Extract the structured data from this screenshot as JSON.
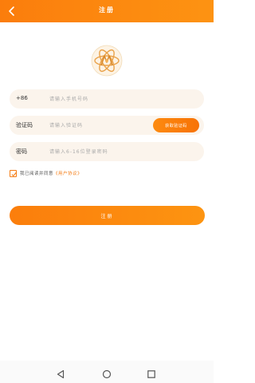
{
  "header": {
    "title": "注册",
    "back_icon": "chevron-left-icon"
  },
  "logo": {
    "icon": "atom-logo-icon"
  },
  "form": {
    "phone": {
      "label": "+86",
      "placeholder": "请输入手机号码"
    },
    "code": {
      "label": "验证码",
      "placeholder": "请输入验证码",
      "button_label": "获取验证码"
    },
    "password": {
      "label": "密码",
      "placeholder": "请输入6-16位登录密码"
    }
  },
  "agreement": {
    "checked": true,
    "text": "我已阅读并同意",
    "link": "《用户协议》"
  },
  "submit": {
    "label": "注册"
  },
  "colors": {
    "accent": "#f77d0b",
    "field_bg": "#fbf4ec"
  }
}
